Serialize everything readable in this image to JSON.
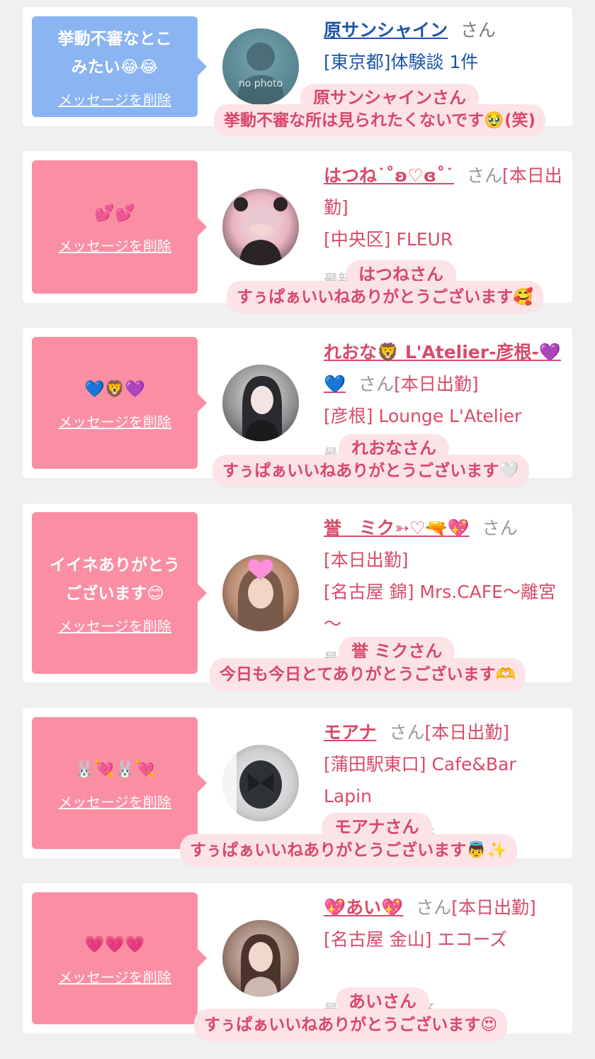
{
  "delete_label": "メッセージを削除",
  "san_label": "さん",
  "hidden_line": "最新の日記を見る",
  "cards": [
    {
      "message": "挙動不審なとこみたい😂😂",
      "name": "原サンシャイン",
      "status": "",
      "line2": "[東京都]体験談 1件",
      "line3": "",
      "avatar_text": "no photo",
      "overlay_name": "原サンシャインさん",
      "overlay_msg": "挙動不審な所は見られたくないです🥹(笑)"
    },
    {
      "message": "💕💕",
      "name": "はつね˙˚ʚ♡ɞ˚˙",
      "status": "[本日出勤]",
      "line2": "[中央区] FLEUR",
      "line3": "",
      "avatar_text": "",
      "overlay_name": "はつねさん",
      "overlay_msg": "すぅぱぁいいねありがとうございます🥰"
    },
    {
      "message": "💙🦁💜",
      "name": "れおな🦁 L'Atelier-彦根-💜💙",
      "status": "[本日出勤]",
      "line2": "[彦根] Lounge L'Atelier",
      "line3": "",
      "avatar_text": "",
      "overlay_name": "れおなさん",
      "overlay_msg": "すぅぱぁいいねありがとうございます🤍"
    },
    {
      "message": "イイネありがとうございます😊",
      "name": "誉　ミク➳♡🔫💖",
      "status": "[本日出勤]",
      "line2": "[名古屋 錦] Mrs.CAFE～離宮～",
      "line3": "",
      "avatar_text": "",
      "overlay_name": "誉 ミクさん",
      "overlay_msg": "今日も今日とてありがとうございます🫶"
    },
    {
      "message": "🐰💘🐰💘",
      "name": "モアナ",
      "status": "[本日出勤]",
      "line2": "[蒲田駅東口] Cafe&Bar Lapin",
      "line3": "",
      "avatar_text": "",
      "overlay_name": "モアナさん",
      "overlay_msg": "すぅぱぁいいねありがとうございます👼✨"
    },
    {
      "message": "💗💗💗",
      "name": "💖あい💖",
      "status": "[本日出勤]",
      "line2": "[名古屋 金山] エコーズ",
      "line3": "",
      "avatar_text": "",
      "overlay_name": "あいさん",
      "overlay_msg": "すぅぱぁいいねありがとうございます😍"
    }
  ],
  "colors": {
    "pink_bubble": "#fa8fa4",
    "blue_bubble": "#8ab4f2",
    "pink_text": "#d94a6a",
    "blue_text": "#1d55a8",
    "overlay_bg": "#fbe3e8"
  }
}
